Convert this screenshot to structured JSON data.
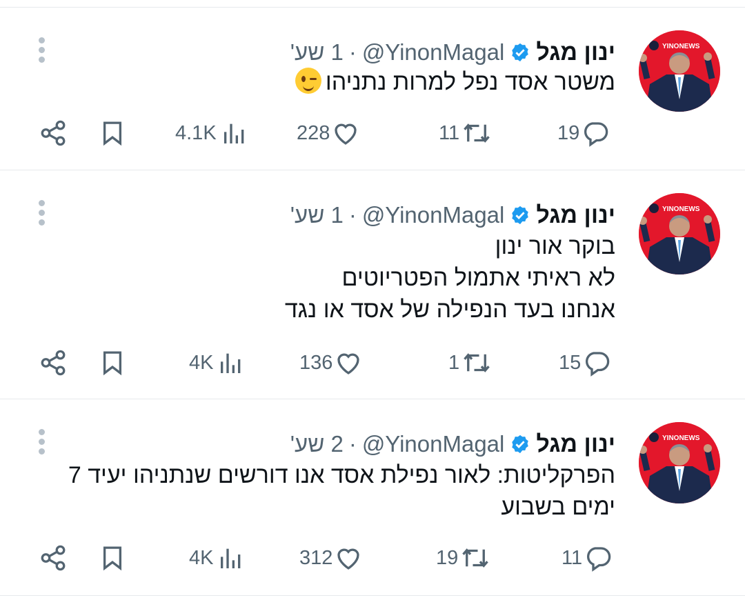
{
  "tweets": [
    {
      "name": "ינון מגל",
      "handle": "@YinonMagal",
      "separator": "·",
      "time": "1 שע'",
      "text": "משטר אסד נפל למרות נתניהו",
      "emoji": "winking-face",
      "replies": "19",
      "retweets": "11",
      "likes": "228",
      "views": "4.1K",
      "avatar_label": "YINONEWS"
    },
    {
      "name": "ינון מגל",
      "handle": "@YinonMagal",
      "separator": "·",
      "time": "1 שע'",
      "text": "בוקר אור ינון\nלא ראיתי אתמול הפטריוטים\nאנחנו בעד הנפילה של אסד או נגד",
      "replies": "15",
      "retweets": "1",
      "likes": "136",
      "views": "4K",
      "avatar_label": "YINONEWS"
    },
    {
      "name": "ינון מגל",
      "handle": "@YinonMagal",
      "separator": "·",
      "time": "2 שע'",
      "text": "הפרקליטות: לאור נפילת אסד אנו דורשים שנתניהו יעיד 7\nימים בשבוע",
      "replies": "11",
      "retweets": "19",
      "likes": "312",
      "views": "4K",
      "avatar_label": "YINONEWS"
    }
  ],
  "colors": {
    "text": "#0f1419",
    "muted": "#536471",
    "verified": "#1d9bf0",
    "divider": "#e6e9ec",
    "avatar_bg": "#e3172b"
  }
}
